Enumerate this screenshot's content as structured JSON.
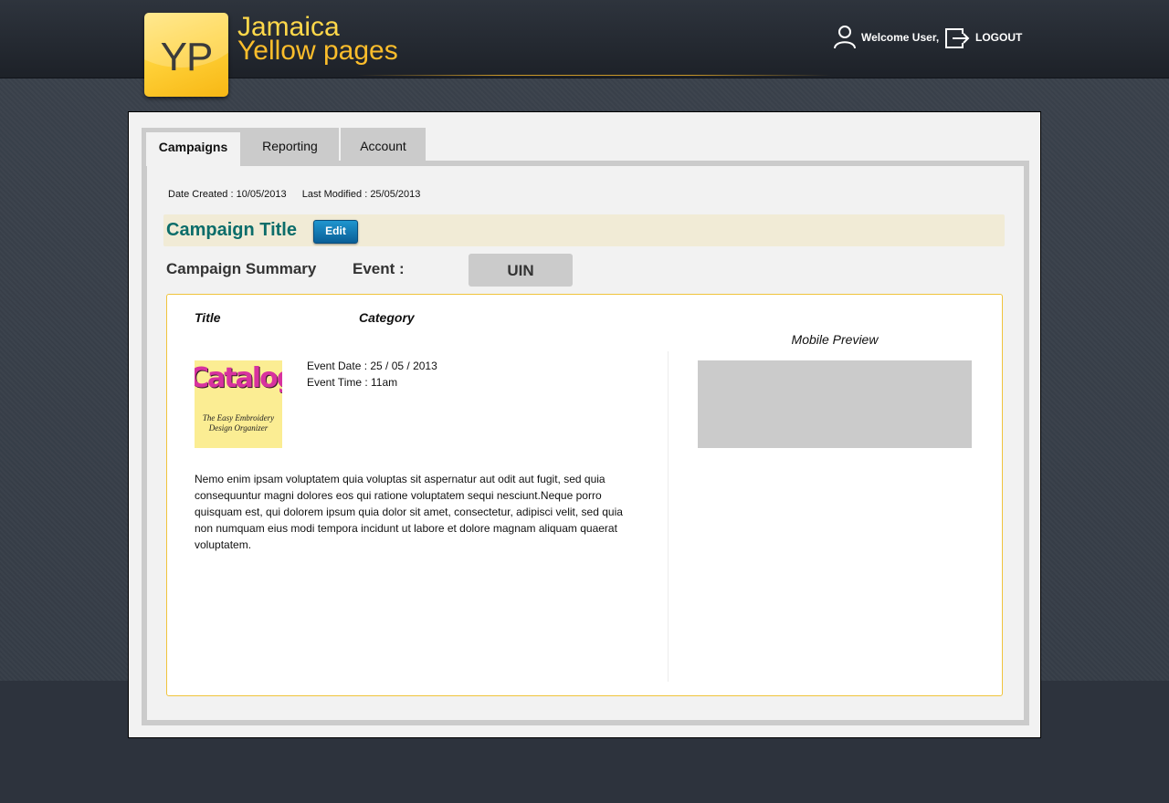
{
  "header": {
    "logo_letters": "YP",
    "brand_line1": "Jamaica",
    "brand_line2": "Yellow pages",
    "welcome_text": "Welcome User,",
    "logout_label": "LOGOUT"
  },
  "tabs": [
    {
      "label": "Campaigns",
      "active": true
    },
    {
      "label": "Reporting",
      "active": false
    },
    {
      "label": "Account",
      "active": false
    }
  ],
  "meta": {
    "date_created": "Date Created : 10/05/2013",
    "last_modified": "Last Modified : 25/05/2013"
  },
  "campaign": {
    "title": "Campaign Title",
    "edit_label": "Edit",
    "summary_label": "Campaign Summary",
    "event_label": "Event :",
    "uin_label": "UIN"
  },
  "card": {
    "col_title": "Title",
    "col_category": "Category",
    "image_logo_text": "Catalogit",
    "image_tagline": "The Easy Embroidery Design Organizer",
    "event_date": "Event Date : 25 / 05 / 2013",
    "event_time": "Event Time : 11am",
    "description": "Nemo enim ipsam voluptatem quia voluptas sit aspernatur aut odit aut fugit, sed quia consequuntur magni dolores eos qui ratione voluptatem sequi nesciunt.Neque porro quisquam est, qui dolorem ipsum quia dolor sit amet, consectetur, adipisci velit, sed quia non numquam eius modi tempora incidunt ut labore et dolore magnam aliquam quaerat voluptatem.",
    "mobile_preview_label": "Mobile Preview"
  },
  "colors": {
    "accent_gold": "#fbbd2b",
    "title_teal": "#0c6d6a",
    "edit_blue": "#0a5f97",
    "card_border": "#f0c43c"
  },
  "icons": [
    "user-icon",
    "logout-icon"
  ]
}
